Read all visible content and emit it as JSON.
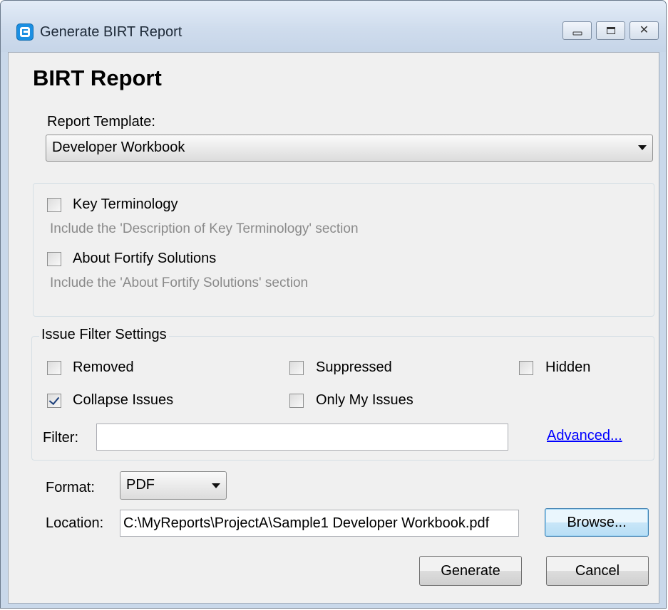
{
  "window": {
    "title": "Generate BIRT Report",
    "minimize_glyph": "",
    "maximize_glyph": "",
    "close_glyph": "✕"
  },
  "heading": "BIRT Report",
  "template": {
    "label": "Report Template:",
    "selected": "Developer Workbook"
  },
  "sections": [
    {
      "label": "Key Terminology",
      "description": "Include the 'Description of Key Terminology' section",
      "checked": false
    },
    {
      "label": "About Fortify Solutions",
      "description": "Include the 'About Fortify Solutions' section",
      "checked": false
    }
  ],
  "issue_filter": {
    "title": "Issue Filter Settings",
    "removed": {
      "label": "Removed",
      "checked": false
    },
    "suppressed": {
      "label": "Suppressed",
      "checked": false
    },
    "hidden": {
      "label": "Hidden",
      "checked": false
    },
    "collapse": {
      "label": "Collapse Issues",
      "checked": true
    },
    "only_mine": {
      "label": "Only My Issues",
      "checked": false
    },
    "filter_label": "Filter:",
    "filter_value": "",
    "advanced_link": "Advanced..."
  },
  "format": {
    "label": "Format:",
    "selected": "PDF"
  },
  "location": {
    "label": "Location:",
    "value": "C:\\MyReports\\ProjectA\\Sample1 Developer Workbook.pdf",
    "browse_label": "Browse..."
  },
  "actions": {
    "generate_label": "Generate",
    "cancel_label": "Cancel"
  }
}
